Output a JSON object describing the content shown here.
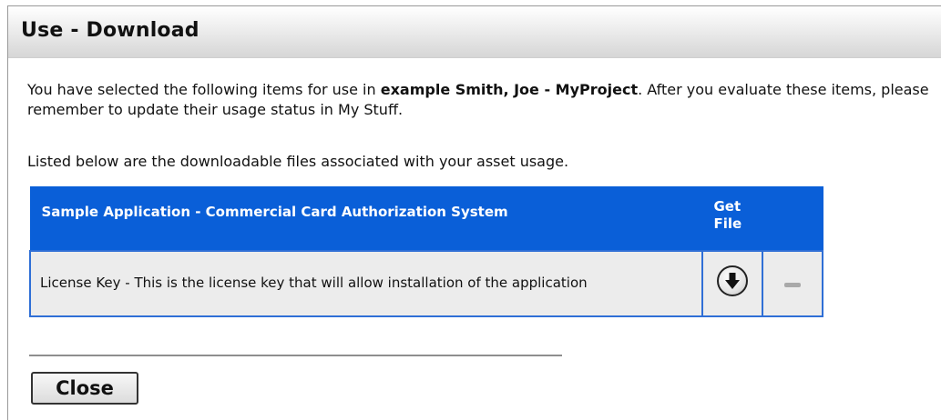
{
  "dialog": {
    "title": "Use - Download"
  },
  "intro": {
    "part1": "You have selected the following items for use in ",
    "project": "example Smith, Joe - MyProject",
    "part2": ". After you evaluate these items, please remember to update their usage status in My Stuff."
  },
  "listed_text": "Listed below are the downloadable files associated with your asset usage.",
  "table": {
    "header_name": "Sample Application - Commercial Card Authorization System",
    "header_get_line1": "Get",
    "header_get_line2": "File",
    "rows": [
      {
        "label": "License Key - This is the license key that will allow installation of the application",
        "download_icon": "download-arrow-circle-icon",
        "action_icon": "minus-dash-icon"
      }
    ]
  },
  "buttons": {
    "close_label": "Close"
  },
  "colors": {
    "header_blue": "#0a5fd8",
    "row_gray": "#ececec"
  }
}
